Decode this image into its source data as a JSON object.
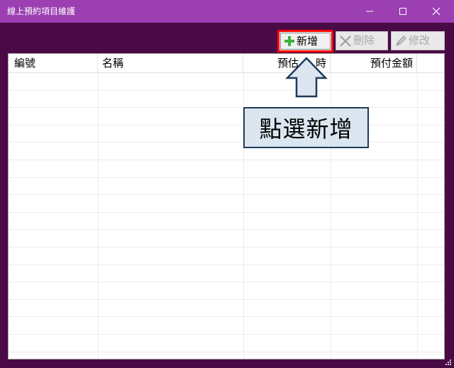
{
  "window": {
    "title": "線上預約項目維護",
    "controls": {
      "minimize": "minimize-icon",
      "maximize": "maximize-icon",
      "close": "close-icon"
    },
    "colors": {
      "titlebar": "#9b3fb2",
      "frame": "#4a0a45"
    }
  },
  "toolbar": {
    "add_label": "新增",
    "delete_label": "刪除",
    "edit_label": "修改",
    "highlight_color": "#ff0000"
  },
  "grid": {
    "columns": [
      "編號",
      "名稱",
      "預估",
      "時",
      "預付金額"
    ],
    "row_count": 16
  },
  "annotation": {
    "callout_text": "點選新增"
  }
}
